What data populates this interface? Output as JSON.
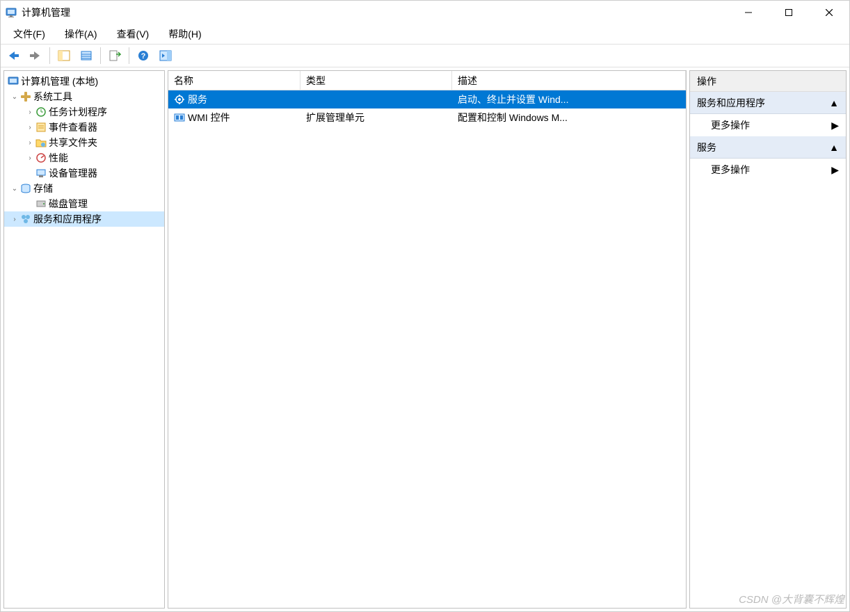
{
  "titlebar": {
    "title": "计算机管理"
  },
  "menubar": {
    "file": "文件(F)",
    "action": "操作(A)",
    "view": "查看(V)",
    "help": "帮助(H)"
  },
  "toolbar_icons": {
    "back": "back-arrow-icon",
    "forward": "forward-arrow-icon",
    "up": "up-folder-icon",
    "show_hide": "show-hide-icon",
    "export": "export-icon",
    "help": "help-icon",
    "play": "play-pane-icon"
  },
  "tree": {
    "root": "计算机管理 (本地)",
    "system_tools": "系统工具",
    "task_scheduler": "任务计划程序",
    "event_viewer": "事件查看器",
    "shared_folders": "共享文件夹",
    "performance": "性能",
    "device_manager": "设备管理器",
    "storage": "存储",
    "disk_management": "磁盘管理",
    "services_apps": "服务和应用程序"
  },
  "list": {
    "headers": {
      "name": "名称",
      "type": "类型",
      "description": "描述"
    },
    "rows": [
      {
        "name": "服务",
        "type": "",
        "description": "启动、终止并设置 Wind..."
      },
      {
        "name": "WMI 控件",
        "type": "扩展管理单元",
        "description": "配置和控制 Windows M..."
      }
    ]
  },
  "actions": {
    "title": "操作",
    "group1": "服务和应用程序",
    "group2": "服务",
    "more": "更多操作"
  },
  "watermark": "CSDN @大背囊不辉煌"
}
